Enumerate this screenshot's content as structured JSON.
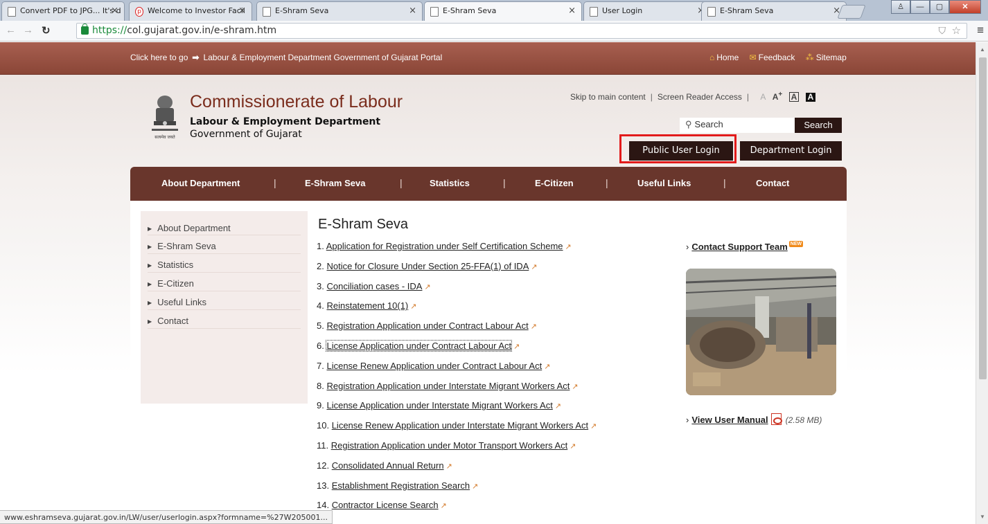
{
  "browser": {
    "tabs": [
      {
        "title": "Convert PDF to JPG... It's d"
      },
      {
        "title": "Welcome to Investor Facil"
      },
      {
        "title": "E-Shram Seva"
      },
      {
        "title": "E-Shram Seva"
      },
      {
        "title": "User Login"
      },
      {
        "title": "E-Shram Seva"
      }
    ],
    "url_scheme": "https://",
    "url_rest": "col.gujarat.gov.in/e-shram.htm",
    "status_url": "www.eshramseva.gujarat.gov.in/LW/user/userlogin.aspx?formname=%27W205001..."
  },
  "topstrip": {
    "goto_prefix": "Click here to go",
    "goto_link": "Labour & Employment Department Government of Gujarat Portal",
    "home": "Home",
    "feedback": "Feedback",
    "sitemap": "Sitemap"
  },
  "header": {
    "title": "Commissionerate of Labour",
    "dept": "Labour & Employment Department",
    "gov": "Government of Gujarat",
    "skip": "Skip to main content",
    "screen_reader": "Screen Reader Access",
    "search_placeholder": "Search",
    "search_button": "Search",
    "public_login": "Public User Login",
    "dept_login": "Department Login"
  },
  "nav": [
    "About Department",
    "E-Shram Seva",
    "Statistics",
    "E-Citizen",
    "Useful Links",
    "Contact"
  ],
  "sidebar": [
    "About Department",
    "E-Shram Seva",
    "Statistics",
    "E-Citizen",
    "Useful Links",
    "Contact"
  ],
  "main": {
    "title": "E-Shram Seva",
    "links": [
      {
        "num": "1.",
        "label": "Application for Registration under Self Certification Scheme"
      },
      {
        "num": "2.",
        "label": "Notice for Closure Under Section 25-FFA(1) of IDA"
      },
      {
        "num": "3.",
        "label": "Conciliation cases - IDA"
      },
      {
        "num": "4.",
        "label": "Reinstatement 10(1)"
      },
      {
        "num": "5.",
        "label": "Registration Application under Contract Labour Act"
      },
      {
        "num": "6.",
        "label": "License Application under Contract Labour Act"
      },
      {
        "num": "7.",
        "label": "License Renew Application under Contract Labour Act"
      },
      {
        "num": "8.",
        "label": "Registration Application under Interstate Migrant Workers Act"
      },
      {
        "num": "9.",
        "label": "License Application under Interstate Migrant Workers Act"
      },
      {
        "num": "10.",
        "label": "License Renew Application under Interstate Migrant Workers Act"
      },
      {
        "num": "11.",
        "label": "Registration Application under Motor Transport Workers Act"
      },
      {
        "num": "12.",
        "label": "Consolidated Annual Return"
      },
      {
        "num": "13.",
        "label": "Establishment Registration Search"
      },
      {
        "num": "14.",
        "label": "Contractor License Search"
      }
    ]
  },
  "right": {
    "support": "Contact Support Team",
    "new_badge": "NEW",
    "manual": "View User Manual",
    "manual_size": "(2.58 MB)"
  },
  "colors": {
    "brand": "#69362c",
    "button": "#2b1613",
    "highlight": "#e21b1b",
    "title": "#7a2c1c"
  }
}
